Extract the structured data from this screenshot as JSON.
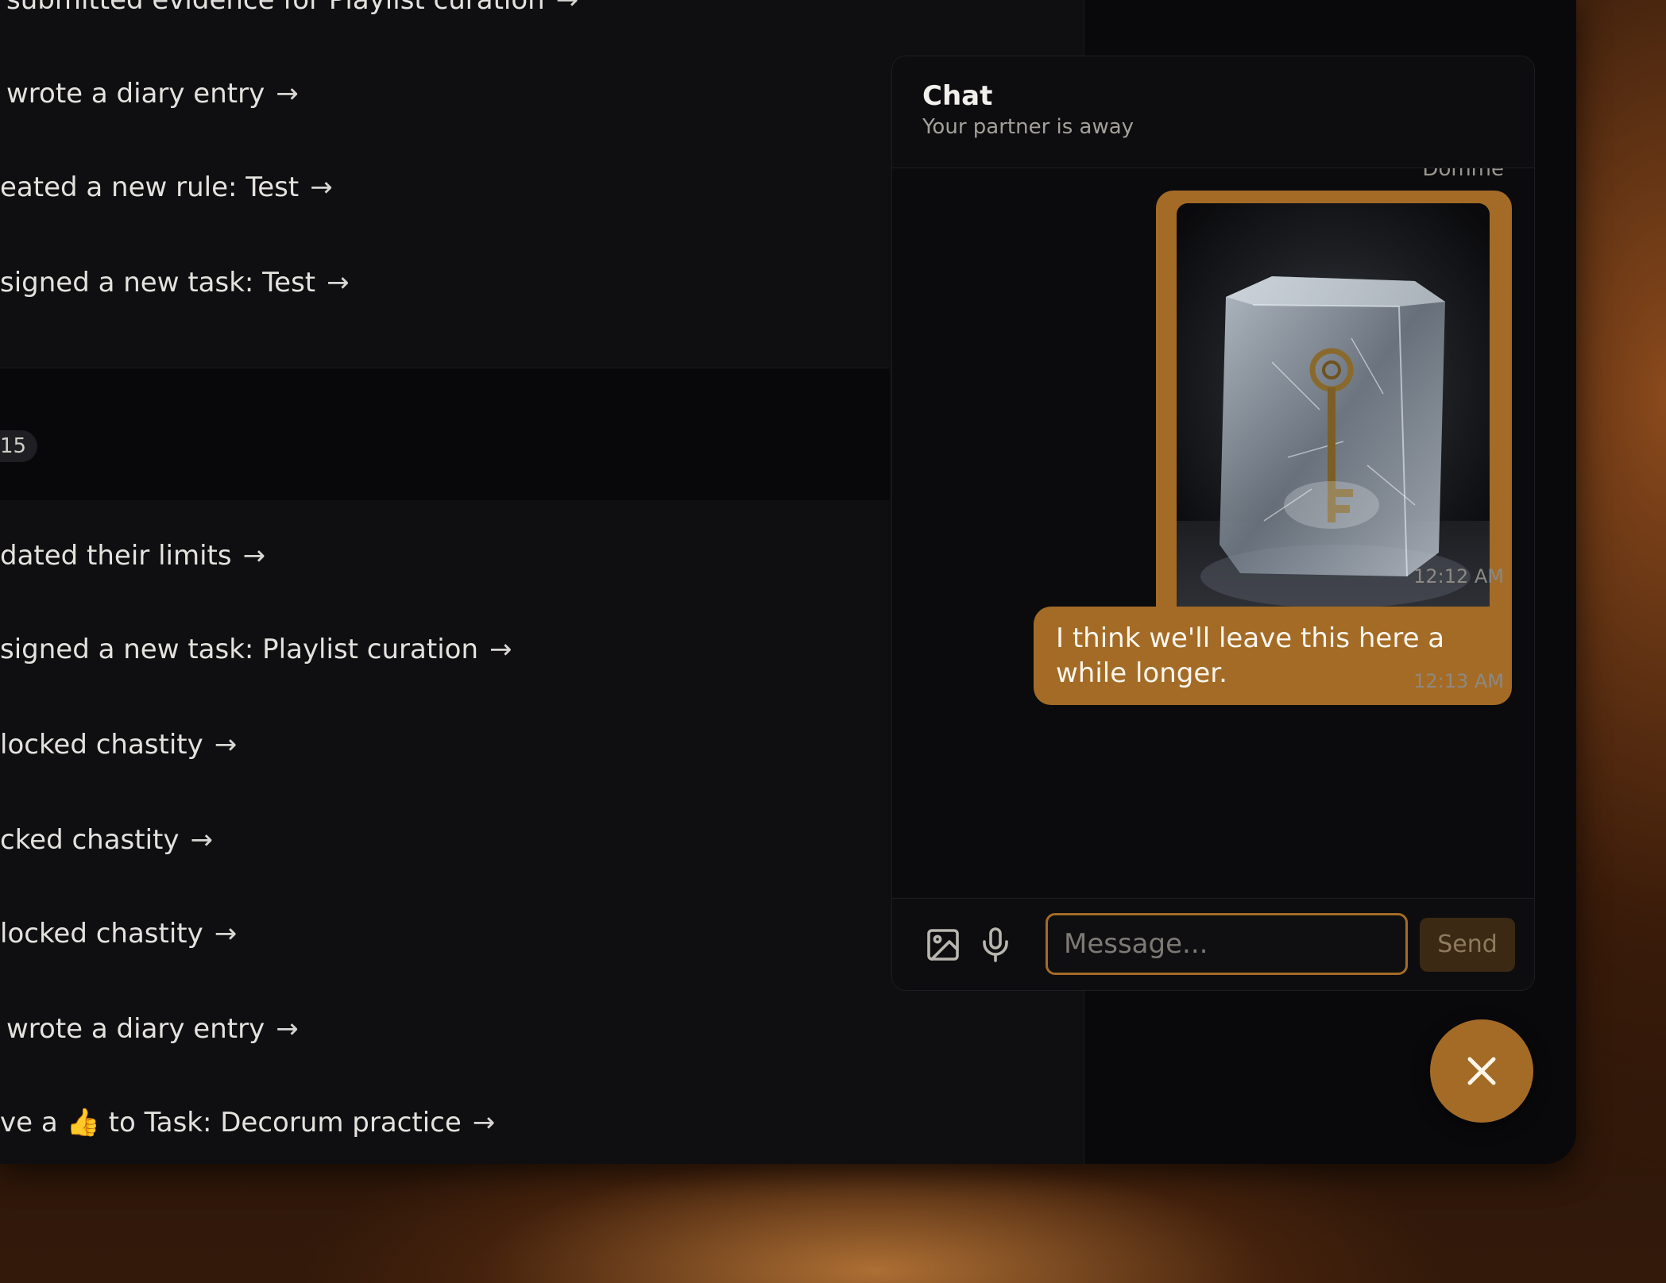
{
  "feed": {
    "top_items": [
      {
        "text": "submitted evidence for Playlist curation",
        "arrow": "→"
      },
      {
        "text": "wrote a diary entry",
        "arrow": "→"
      },
      {
        "text": "eated a new rule: Test",
        "arrow": "→"
      },
      {
        "text": "signed a new task: Test",
        "arrow": "→"
      }
    ],
    "date_chip": "15",
    "bottom_items": [
      {
        "text": "dated their limits",
        "arrow": "→"
      },
      {
        "text": "signed a new task: Playlist curation",
        "arrow": "→"
      },
      {
        "text": "locked chastity",
        "arrow": "→"
      },
      {
        "text": "cked chastity",
        "arrow": "→"
      },
      {
        "text": "locked chastity",
        "arrow": "→"
      },
      {
        "text": "wrote a diary entry",
        "arrow": "→"
      },
      {
        "text_before": "ve a",
        "emoji": "👍",
        "text_after": "to Task: Decorum practice",
        "arrow": "→"
      }
    ]
  },
  "chat": {
    "title": "Chat",
    "status": "Your partner is away",
    "sender_name": "Domme",
    "messages": [
      {
        "type": "image",
        "image_name": "key-in-ice-image",
        "time": "12:12 AM"
      },
      {
        "type": "text",
        "text": "I think we'll leave this here a while longer.",
        "time": "12:13 AM"
      }
    ],
    "composer": {
      "image_icon": "image-icon",
      "mic_icon": "microphone-icon",
      "placeholder": "Message...",
      "value": "",
      "send_label": "Send"
    }
  },
  "close_button": {
    "icon": "close-icon"
  },
  "colors": {
    "accent": "#a46b26",
    "window_bg": "#0f0f11",
    "panel_bg": "#0b0b0d",
    "text": "#e4e2de"
  }
}
